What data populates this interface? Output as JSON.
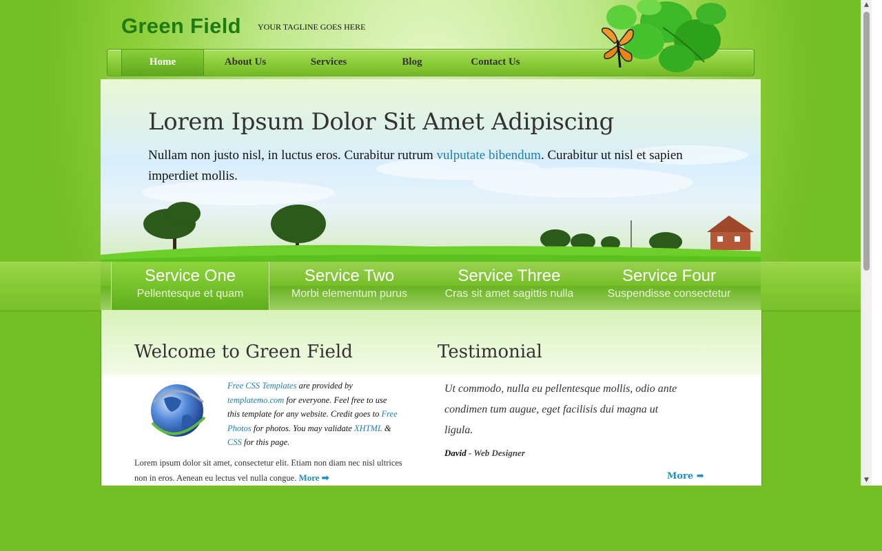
{
  "header": {
    "logo": "Green Field",
    "tagline": "YOUR TAGLINE GOES HERE"
  },
  "nav": {
    "items": [
      {
        "label": "Home",
        "active": true
      },
      {
        "label": "About Us",
        "active": false
      },
      {
        "label": "Services",
        "active": false
      },
      {
        "label": "Blog",
        "active": false
      },
      {
        "label": "Contact Us",
        "active": false
      }
    ]
  },
  "banner": {
    "title": "Lorem Ipsum Dolor Sit Amet Adipiscing",
    "text_before": "Nullam non justo nisl, in luctus eros. Curabitur rutrum ",
    "link": "vulputate bibendum",
    "text_after": ". Curabitur ut nisl et sapien imperdiet mollis."
  },
  "services": [
    {
      "title": "Service One",
      "subtitle": "Pellentesque et quam",
      "active": true
    },
    {
      "title": "Service Two",
      "subtitle": "Morbi elementum purus",
      "active": false
    },
    {
      "title": "Service Three",
      "subtitle": "Cras sit amet sagittis nulla",
      "active": false
    },
    {
      "title": "Service Four",
      "subtitle": "Suspendisse consectetur",
      "active": false
    }
  ],
  "welcome": {
    "heading": "Welcome to Green Field",
    "link1": "Free CSS Templates",
    "t1": " are provided by ",
    "link2": "templatemo.com",
    "t2": " for everyone. Feel free to use this template for any website. Credit goes to ",
    "link3": "Free Photos",
    "t3": " for photos. You may validate ",
    "link4": "XHTML",
    "t4": " & ",
    "link5": "CSS",
    "t5": " for this page.",
    "paragraph": "Lorem ipsum dolor sit amet, consectetur elit. Etiam non diam nec nisl ultrices non in eros. Aenean eu lectus vel nulla congue. ",
    "more": "More ➡"
  },
  "testimonial": {
    "heading": "Testimonial",
    "quote": "Ut commodo, nulla eu pellentesque mollis, odio ante condimen tum augue, eget facilisis dui magna ut ligula.",
    "author": "David",
    "role": " - Web Designer",
    "more": "More ➡"
  },
  "icons": {
    "globe": "globe-icon",
    "butterfly": "butterfly-icon",
    "scroll_up": "▲",
    "scroll_down": "▼"
  },
  "colors": {
    "background": "#74be26",
    "logo": "#1f7a10",
    "link": "#1d7fb0"
  }
}
